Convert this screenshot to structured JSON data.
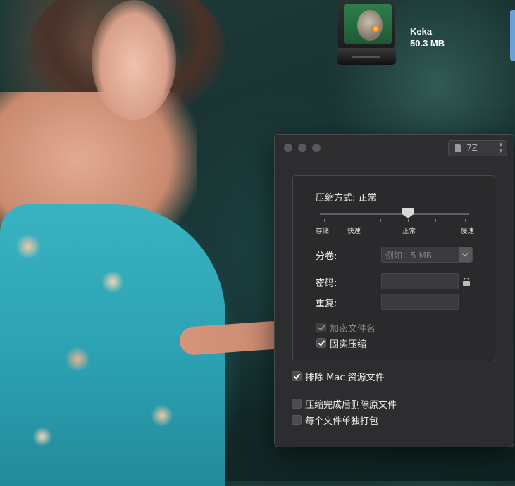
{
  "desktop": {
    "app_name": "Keka",
    "app_size": "50.3 MB"
  },
  "window": {
    "format_value": "7Z",
    "compression": {
      "label": "压缩方式: 正常",
      "levels": [
        "存储",
        "快速",
        "正常",
        "慢速"
      ],
      "selected_level": "正常"
    },
    "split": {
      "label": "分卷:",
      "placeholder": "例如：5 MB"
    },
    "password": {
      "label": "密码:",
      "value": ""
    },
    "repeat": {
      "label": "重复:",
      "value": ""
    },
    "options_inner": [
      {
        "label": "加密文件名",
        "checked": true,
        "disabled": true
      },
      {
        "label": "固实压缩",
        "checked": true,
        "disabled": false
      }
    ],
    "options_outer": [
      {
        "label": "排除 Mac 资源文件",
        "checked": true
      },
      {
        "label": "压缩完成后删除原文件",
        "checked": false
      },
      {
        "label": "每个文件单独打包",
        "checked": false
      }
    ]
  },
  "colors": {
    "window_bg": "#2d2d2f",
    "group_border": "#48484a",
    "text": "#e6e6e6",
    "disabled_text": "#858587"
  }
}
